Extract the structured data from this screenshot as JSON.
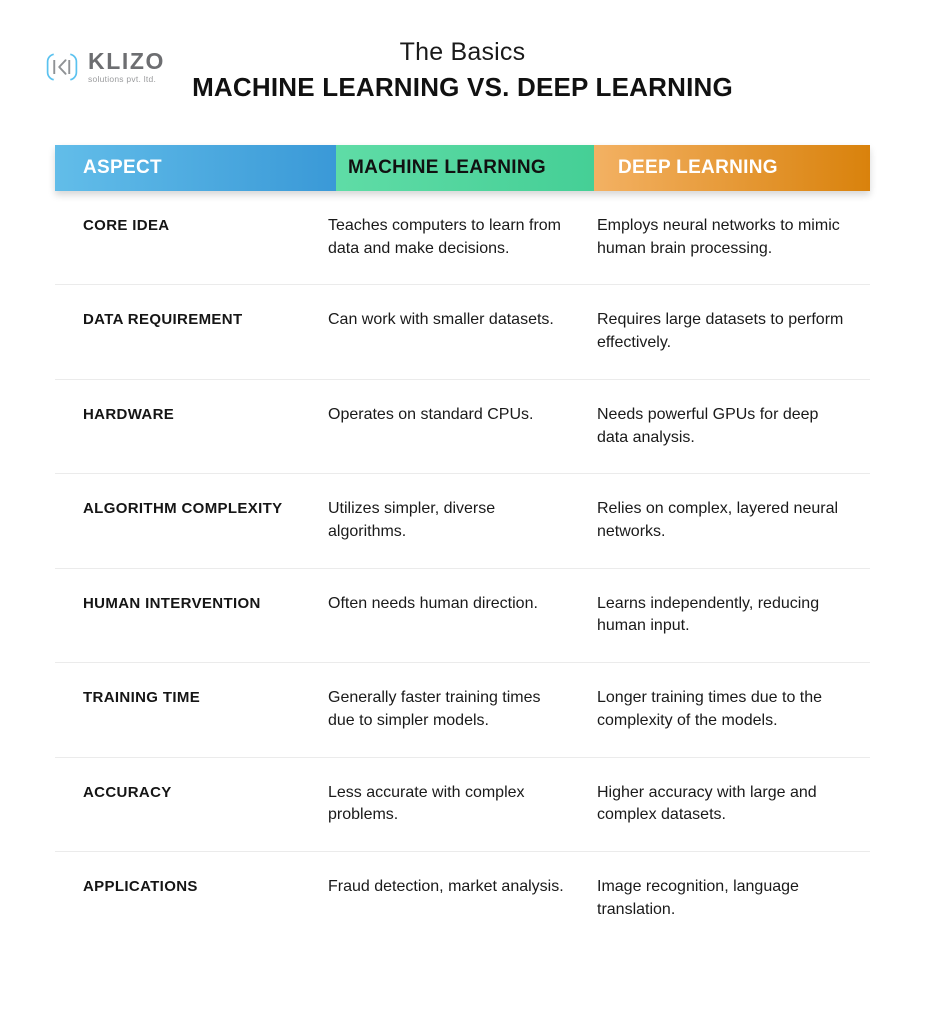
{
  "brand": {
    "name": "KLIZO",
    "tagline": "solutions pvt. ltd.",
    "mark_color": "#5bc2ef",
    "name_color": "#6d6e71"
  },
  "header": {
    "eyebrow": "The Basics",
    "title": "MACHINE LEARNING VS. DEEP LEARNING"
  },
  "table": {
    "columns": [
      {
        "label": "ASPECT",
        "start_color": "#62bde9",
        "end_color": "#3a99d7",
        "text_color": "#ffffff"
      },
      {
        "label": "MACHINE LEARNING",
        "start_color": "#5fdca6",
        "end_color": "#45cf96",
        "text_color": "#111111"
      },
      {
        "label": "DEEP LEARNING",
        "start_color": "#f3b163",
        "end_color": "#d9820c",
        "text_color": "#ffffff"
      }
    ],
    "rows": [
      {
        "aspect": "CORE IDEA",
        "machine_learning": "Teaches computers to learn from data and make decisions.",
        "deep_learning": "Employs neural networks to mimic human brain processing."
      },
      {
        "aspect": "DATA REQUIREMENT",
        "machine_learning": "Can work with smaller datasets.",
        "deep_learning": "Requires large datasets to perform effectively."
      },
      {
        "aspect": "HARDWARE",
        "machine_learning": "Operates on standard CPUs.",
        "deep_learning": "Needs powerful GPUs for deep data analysis."
      },
      {
        "aspect": "ALGORITHM COMPLEXITY",
        "machine_learning": "Utilizes simpler, diverse algorithms.",
        "deep_learning": "Relies on complex, layered neural networks."
      },
      {
        "aspect": "HUMAN INTERVENTION",
        "machine_learning": "Often needs human direction.",
        "deep_learning": "Learns independently, reducing human input."
      },
      {
        "aspect": "TRAINING TIME",
        "machine_learning": "Generally faster training times due to simpler models.",
        "deep_learning": "Longer training times due to the complexity of the models."
      },
      {
        "aspect": "ACCURACY",
        "machine_learning": "Less accurate with complex problems.",
        "deep_learning": "Higher accuracy with large and complex datasets."
      },
      {
        "aspect": "APPLICATIONS",
        "machine_learning": "Fraud detection, market analysis.",
        "deep_learning": "Image recognition, language translation."
      }
    ]
  }
}
